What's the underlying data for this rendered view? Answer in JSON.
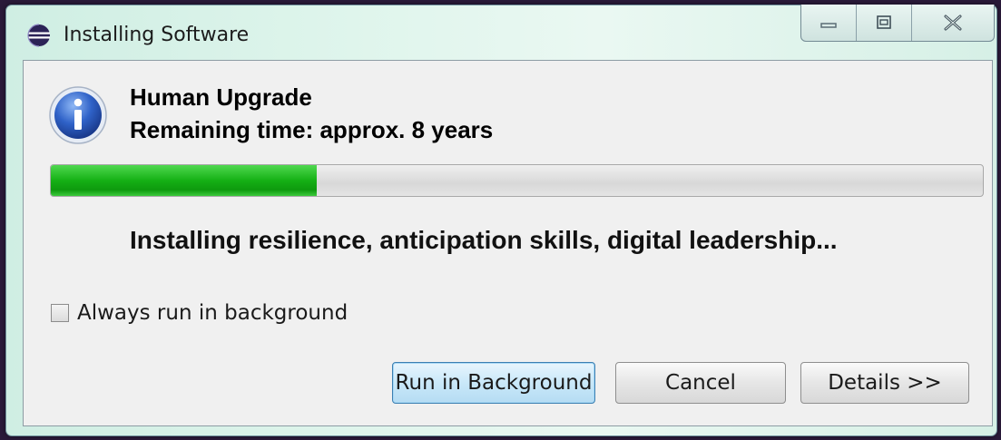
{
  "window": {
    "title": "Installing Software",
    "title_icon": "eclipse-icon",
    "controls": {
      "minimize": "minimize-icon",
      "maximize": "maximize-icon",
      "close": "close-icon"
    }
  },
  "dialog": {
    "icon": "info-icon",
    "heading": "Human Upgrade",
    "remaining": "Remaining time: approx. 8 years",
    "progress_fraction": 0.285,
    "status": "Installing resilience, anticipation skills, digital leadership...",
    "checkbox_label": "Always run in background",
    "checkbox_checked": false,
    "buttons": {
      "run_background": "Run in Background",
      "cancel": "Cancel",
      "details": "Details >>"
    }
  },
  "colors": {
    "progress_green": "#15b015",
    "default_button_border": "#3c7fb1"
  }
}
